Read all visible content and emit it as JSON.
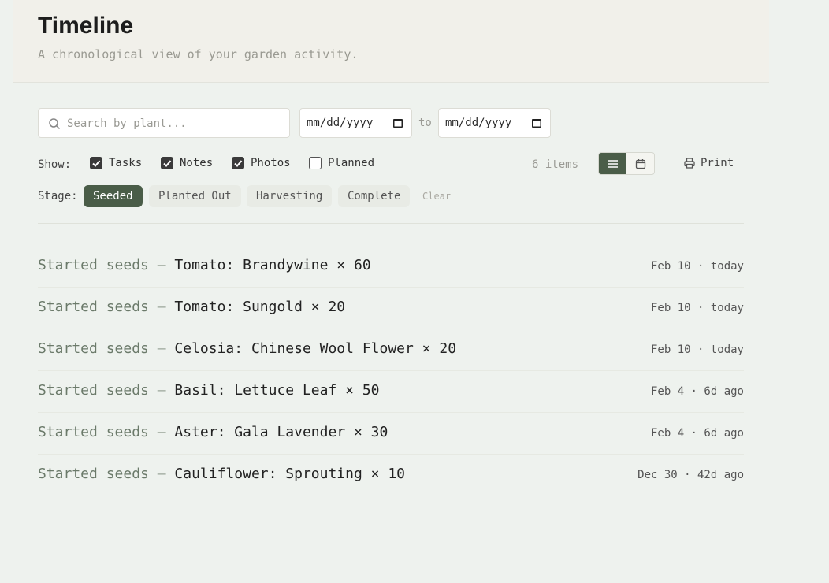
{
  "header": {
    "title": "Timeline",
    "subtitle": "A chronological view of your garden activity."
  },
  "filters": {
    "search_placeholder": "Search by plant...",
    "date_from": "mm/dd/yyyy",
    "date_to": "mm/dd/yyyy",
    "to_label": "to",
    "show_label": "Show:",
    "types": [
      {
        "label": "Tasks",
        "checked": true
      },
      {
        "label": "Notes",
        "checked": true
      },
      {
        "label": "Photos",
        "checked": true
      },
      {
        "label": "Planned",
        "checked": false
      }
    ],
    "items_count": "6 items",
    "print_label": "Print",
    "stage_label": "Stage:",
    "stages": [
      {
        "label": "Seeded",
        "active": true
      },
      {
        "label": "Planted Out",
        "active": false
      },
      {
        "label": "Harvesting",
        "active": false
      },
      {
        "label": "Complete",
        "active": false
      }
    ],
    "clear_label": "Clear"
  },
  "entries": [
    {
      "action": "Started seeds",
      "subject": "Tomato: Brandywine × 60",
      "when": "Feb 10 · today"
    },
    {
      "action": "Started seeds",
      "subject": "Tomato: Sungold × 20",
      "when": "Feb 10 · today"
    },
    {
      "action": "Started seeds",
      "subject": "Celosia: Chinese Wool Flower × 20",
      "when": "Feb 10 · today"
    },
    {
      "action": "Started seeds",
      "subject": "Basil: Lettuce Leaf × 50",
      "when": "Feb 4 · 6d ago"
    },
    {
      "action": "Started seeds",
      "subject": "Aster: Gala Lavender × 30",
      "when": "Feb 4 · 6d ago"
    },
    {
      "action": "Started seeds",
      "subject": "Cauliflower: Sprouting × 10",
      "when": "Dec 30 · 42d ago"
    }
  ],
  "colors": {
    "accent": "#4a5d48",
    "background": "#eef2ee",
    "header_bg": "#f1f0ea"
  }
}
